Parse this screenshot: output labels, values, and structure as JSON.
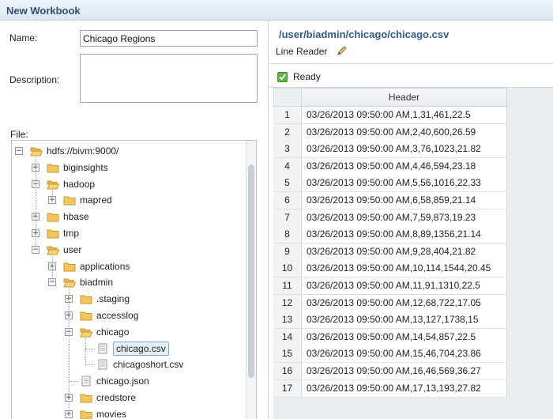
{
  "window": {
    "title": "New Workbook"
  },
  "form": {
    "name_label": "Name:",
    "name_value": "Chicago Regions",
    "description_label": "Description:",
    "description_value": "",
    "file_label": "File:"
  },
  "tree": {
    "nodes": [
      {
        "label": "hdfs://bivm:9000/",
        "type": "folder-open",
        "toggle": "−",
        "level": 0
      },
      {
        "label": "biginsights",
        "type": "folder",
        "toggle": "+",
        "level": 1
      },
      {
        "label": "hadoop",
        "type": "folder-open",
        "toggle": "−",
        "level": 1
      },
      {
        "label": "mapred",
        "type": "folder",
        "toggle": "+",
        "level": 2
      },
      {
        "label": "hbase",
        "type": "folder",
        "toggle": "+",
        "level": 1
      },
      {
        "label": "tmp",
        "type": "folder",
        "toggle": "+",
        "level": 1
      },
      {
        "label": "user",
        "type": "folder-open",
        "toggle": "−",
        "level": 1
      },
      {
        "label": "applications",
        "type": "folder",
        "toggle": "+",
        "level": 2
      },
      {
        "label": "biadmin",
        "type": "folder-open",
        "toggle": "−",
        "level": 2
      },
      {
        "label": ".staging",
        "type": "folder",
        "toggle": "+",
        "level": 3
      },
      {
        "label": "accesslog",
        "type": "folder",
        "toggle": "+",
        "level": 3
      },
      {
        "label": "chicago",
        "type": "folder-open",
        "toggle": "−",
        "level": 3
      },
      {
        "label": "chicago.csv",
        "type": "file",
        "toggle": "",
        "level": 4,
        "selected": true
      },
      {
        "label": "chicagoshort.csv",
        "type": "file",
        "toggle": "",
        "level": 4
      },
      {
        "label": "chicago.json",
        "type": "file",
        "toggle": "",
        "level": 3
      },
      {
        "label": "credstore",
        "type": "folder",
        "toggle": "+",
        "level": 3
      },
      {
        "label": "movies",
        "type": "folder",
        "toggle": "+",
        "level": 3
      }
    ]
  },
  "preview": {
    "path": "/user/biadmin/chicago/chicago.csv",
    "reader_label": "Line Reader",
    "status": "Ready",
    "column_header": "Header",
    "rows": [
      {
        "num": "1",
        "value": "03/26/2013 09:50:00 AM,1,31,461,22.5"
      },
      {
        "num": "2",
        "value": "03/26/2013 09:50:00 AM,2,40,600,26.59"
      },
      {
        "num": "3",
        "value": "03/26/2013 09:50:00 AM,3,76,1023,21.82"
      },
      {
        "num": "4",
        "value": "03/26/2013 09:50:00 AM,4,46,594,23.18"
      },
      {
        "num": "5",
        "value": "03/26/2013 09:50:00 AM,5,56,1016,22.33"
      },
      {
        "num": "6",
        "value": "03/26/2013 09:50:00 AM,6,58,859,21.14"
      },
      {
        "num": "7",
        "value": "03/26/2013 09:50:00 AM,7,59,873,19.23"
      },
      {
        "num": "8",
        "value": "03/26/2013 09:50:00 AM,8,89,1356,21.14"
      },
      {
        "num": "9",
        "value": "03/26/2013 09:50:00 AM,9,28,404,21.82"
      },
      {
        "num": "10",
        "value": "03/26/2013 09:50:00 AM,10,114,1544,20.45"
      },
      {
        "num": "11",
        "value": "03/26/2013 09:50:00 AM,11,91,1310,22.5"
      },
      {
        "num": "12",
        "value": "03/26/2013 09:50:00 AM,12,68,722,17.05"
      },
      {
        "num": "13",
        "value": "03/26/2013 09:50:00 AM,13,127,1738,15"
      },
      {
        "num": "14",
        "value": "03/26/2013 09:50:00 AM,14,54,857,22.5"
      },
      {
        "num": "15",
        "value": "03/26/2013 09:50:00 AM,15,46,704,23.86"
      },
      {
        "num": "16",
        "value": "03/26/2013 09:50:00 AM,16,46,569,36.27"
      },
      {
        "num": "17",
        "value": "03/26/2013 09:50:00 AM,17,13,193,27.82"
      }
    ]
  },
  "icons": {
    "folder": "folder-icon",
    "folder_open": "folder-open-icon",
    "file": "file-icon",
    "edit": "pencil-icon",
    "status": "check-icon"
  },
  "colors": {
    "title_text": "#2e4f78",
    "path_text": "#2e5c8a",
    "folder": "#f3c55a",
    "ready_check": "#5fb545",
    "selection_border": "#7aa6d8"
  }
}
